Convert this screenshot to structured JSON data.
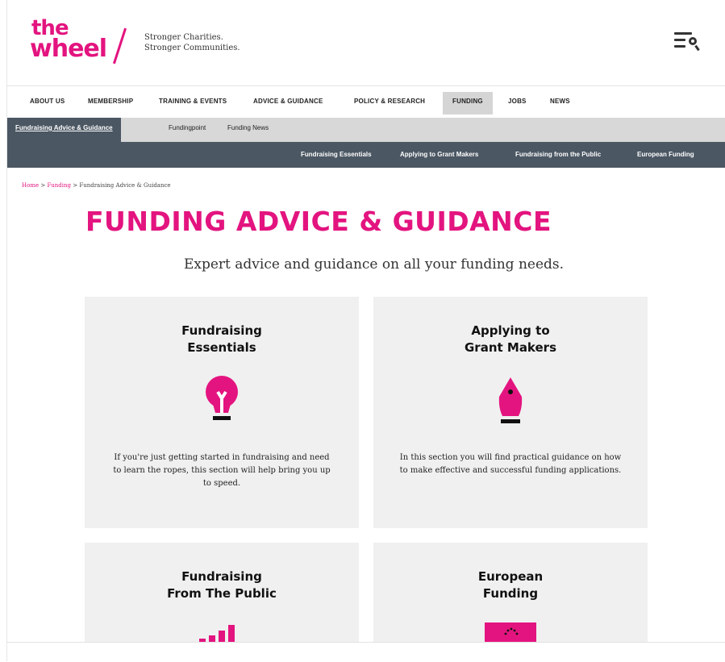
{
  "brand": {
    "logo_top": "the",
    "logo_bottom": "wheel",
    "tagline_line1": "Stronger Charities.",
    "tagline_line2": "Stronger Communities.",
    "accent_color": "#e3147f",
    "dark_nav_color": "#4b5763"
  },
  "header": {
    "menu_icon": "menu-search-icon"
  },
  "main_nav": [
    {
      "label": "ABOUT US"
    },
    {
      "label": "MEMBERSHIP"
    },
    {
      "label": "TRAINING & EVENTS"
    },
    {
      "label": "ADVICE & GUIDANCE"
    },
    {
      "label": "POLICY & RESEARCH"
    },
    {
      "label": "FUNDING"
    },
    {
      "label": "JOBS"
    },
    {
      "label": "NEWS"
    }
  ],
  "sub_nav": [
    {
      "label": "Fundraising Advice & Guidance"
    },
    {
      "label": "Fundingpoint"
    },
    {
      "label": "Funding News"
    }
  ],
  "sub_nav2": [
    {
      "label": "Fundraising Essentials"
    },
    {
      "label": "Applying to Grant Makers"
    },
    {
      "label": "Fundraising from the Public"
    },
    {
      "label": "European Funding"
    }
  ],
  "breadcrumb": {
    "home": "Home",
    "sep1": " > ",
    "funding": "Funding",
    "sep2": " > ",
    "current": "Fundraising Advice & Guidance"
  },
  "page": {
    "title": "FUNDING ADVICE & GUIDANCE",
    "subtitle": "Expert advice and guidance on all your funding needs."
  },
  "cards": [
    {
      "title_line1": "Fundraising",
      "title_line2": "Essentials",
      "icon": "lightbulb-icon",
      "desc": "If you're just getting started in fundraising and need to learn the ropes, this section will help bring you up to speed."
    },
    {
      "title_line1": "Applying to",
      "title_line2": "Grant Makers",
      "icon": "pen-nib-icon",
      "desc": "In this section you will find practical guidance on how to make effective and successful funding applications."
    },
    {
      "title_line1": "Fundraising",
      "title_line2": "From The Public",
      "icon": "bar-chart-icon",
      "desc": ""
    },
    {
      "title_line1": "European",
      "title_line2": "Funding",
      "icon": "eu-flag-icon",
      "desc": ""
    }
  ]
}
